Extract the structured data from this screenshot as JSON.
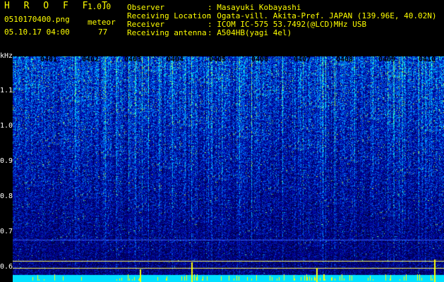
{
  "header": {
    "app_name": "H R O F F T",
    "version": "1.0.0",
    "filename": "0510170400.png",
    "mode": "meteor",
    "datetime": "05.10.17 04:00",
    "count": "77"
  },
  "info": {
    "observer_label": "Observer",
    "observer_value": ": Masayuki Kobayashi",
    "location_label": "Receiving Location",
    "location_value": ": Ogata-vill. Akita-Pref. JAPAN (139.96E, 40.02N)",
    "receiver_label": "Receiver",
    "receiver_value": ": ICOM IC-575 53.7492(@LCD)MHz USB",
    "antenna_label": "Receiving antenna",
    "antenna_value": ": A504HB(yagi 4el)"
  },
  "axis": {
    "unit": "kHz",
    "y_ticks": [
      "1.1",
      "1.0",
      "0.9",
      "0.8",
      "0.7",
      "0.6"
    ],
    "x_ticks": [
      "0401",
      "0402",
      "0403",
      "0404",
      "0405",
      "0406",
      "0407",
      "0408",
      "0409",
      "0410"
    ]
  },
  "colors": {
    "background": "#000000",
    "header_text": "#ffff00",
    "label_text": "#ffffff",
    "spectrum_low": "#0000aa",
    "spectrum_high": "#00ffff"
  }
}
